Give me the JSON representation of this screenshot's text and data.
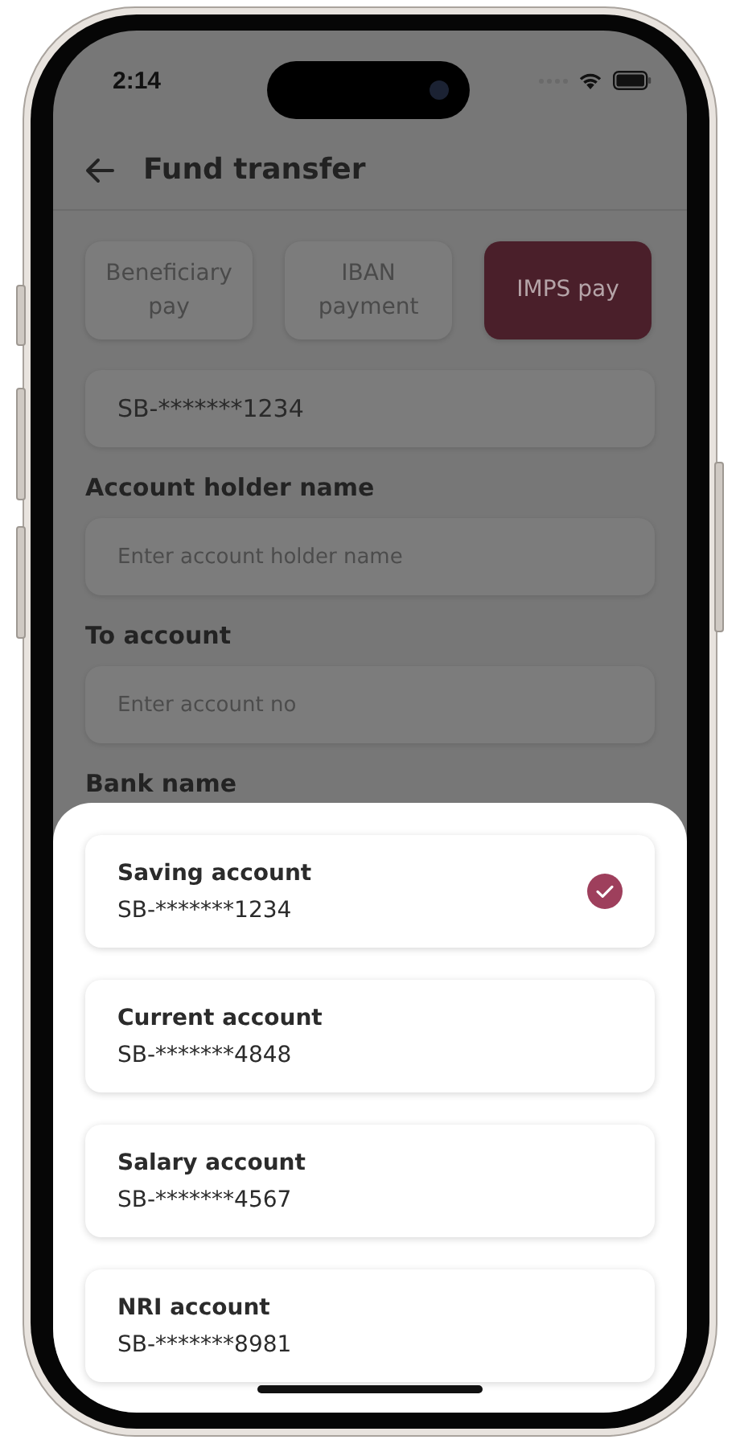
{
  "status_bar": {
    "time": "2:14"
  },
  "header": {
    "title": "Fund transfer"
  },
  "tabs": [
    {
      "label": "Beneficiary pay",
      "selected": false
    },
    {
      "label": "IBAN payment",
      "selected": false
    },
    {
      "label": "IMPS pay",
      "selected": true
    }
  ],
  "from_account": {
    "value": "SB-*******1234"
  },
  "fields": [
    {
      "label": "Account holder name",
      "placeholder": "Enter account holder name"
    },
    {
      "label": "To account",
      "placeholder": "Enter account no"
    }
  ],
  "partial_label": "Bank name",
  "account_sheet": {
    "accounts": [
      {
        "name": "Saving account",
        "number": "SB-*******1234",
        "selected": true
      },
      {
        "name": "Current account",
        "number": "SB-*******4848",
        "selected": false
      },
      {
        "name": "Salary account",
        "number": "SB-*******4567",
        "selected": false
      },
      {
        "name": "NRI account",
        "number": "SB-*******8981",
        "selected": false
      }
    ]
  }
}
